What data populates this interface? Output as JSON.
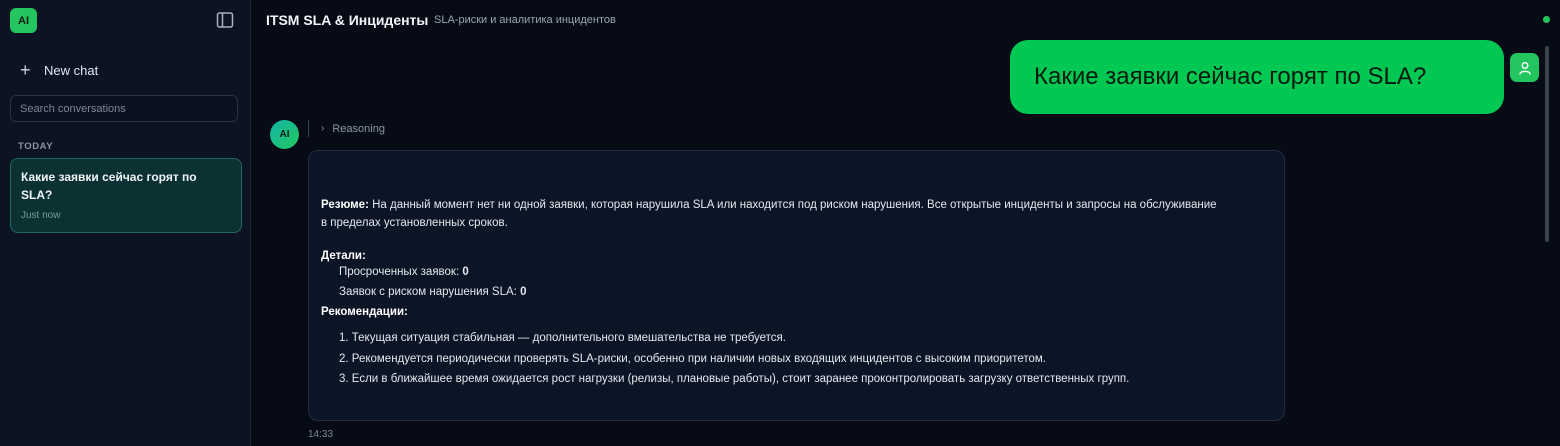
{
  "sidebar": {
    "logo": "AI",
    "new_chat_label": "New chat",
    "search_placeholder": "Search conversations",
    "section_today": "TODAY",
    "conversations": [
      {
        "title": "Какие заявки сейчас горят по SLA?",
        "time": "Just now"
      }
    ]
  },
  "header": {
    "title": "ITSM SLA & Инциденты",
    "subtitle": "SLA-риски и аналитика инцидентов",
    "status_color": "#22c55e"
  },
  "chat": {
    "user_message": "Какие заявки сейчас горят по SLA?",
    "ai_avatar": "AI",
    "reasoning_label": "Reasoning",
    "response": {
      "summary_label": "Резюме:",
      "summary_text": " На данный момент нет ни одной заявки, которая нарушила SLA или находится под риском нарушения. Все открытые инциденты и запросы на обслуживание в пределах установленных сроков.",
      "details_heading": "Детали:",
      "details": [
        {
          "label": "Просроченных заявок: ",
          "value": "0"
        },
        {
          "label": "Заявок с риском нарушения SLA: ",
          "value": "0"
        }
      ],
      "recommendations_heading": "Рекомендации:",
      "recommendations": [
        "1. Текущая ситуация стабильная — дополнительного вмешательства не требуется.",
        "2. Рекомендуется периодически проверять SLA-риски, особенно при наличии новых входящих инцидентов с высоким приоритетом.",
        "3. Если в ближайшее время ожидается рост нагрузки (релизы, плановые работы), стоит заранее проконтролировать загрузку ответственных групп."
      ]
    },
    "message_time": "14:33"
  },
  "colors": {
    "accent": "#22c55e",
    "user_bubble": "#00c853",
    "background": "#060b16"
  }
}
